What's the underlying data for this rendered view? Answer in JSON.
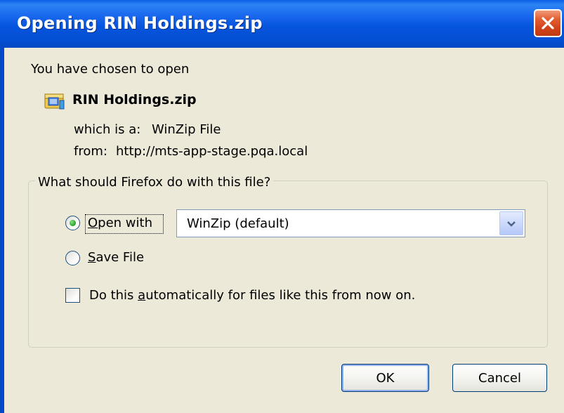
{
  "window": {
    "title": "Opening RIN Holdings.zip"
  },
  "intro": "You have chosen to open",
  "file": {
    "name": "RIN Holdings.zip",
    "type_label": "which is a:",
    "type_value": "WinZip File",
    "from_label": "from:",
    "from_value": "http://mts-app-stage.pqa.local"
  },
  "action_group": {
    "legend": "What should Firefox do with this file?",
    "open_with": {
      "label_pre": "",
      "label_key": "O",
      "label_post": "pen with",
      "selected": true
    },
    "app_select": {
      "value": "WinZip (default)"
    },
    "save_file": {
      "label_pre": "",
      "label_key": "S",
      "label_post": "ave File",
      "selected": false
    },
    "auto": {
      "label_pre": "Do this ",
      "label_key": "a",
      "label_post": "utomatically for files like this from now on.",
      "checked": false
    }
  },
  "buttons": {
    "ok": "OK",
    "cancel": "Cancel"
  },
  "icons": {
    "close": "close-icon",
    "file": "zip-file-icon",
    "dropdown": "chevron-down-icon"
  },
  "colors": {
    "titlebar": "#0655DE",
    "close": "#D0431A",
    "dialog_bg": "#ECE9D8",
    "radio_selected": "#21A121"
  }
}
